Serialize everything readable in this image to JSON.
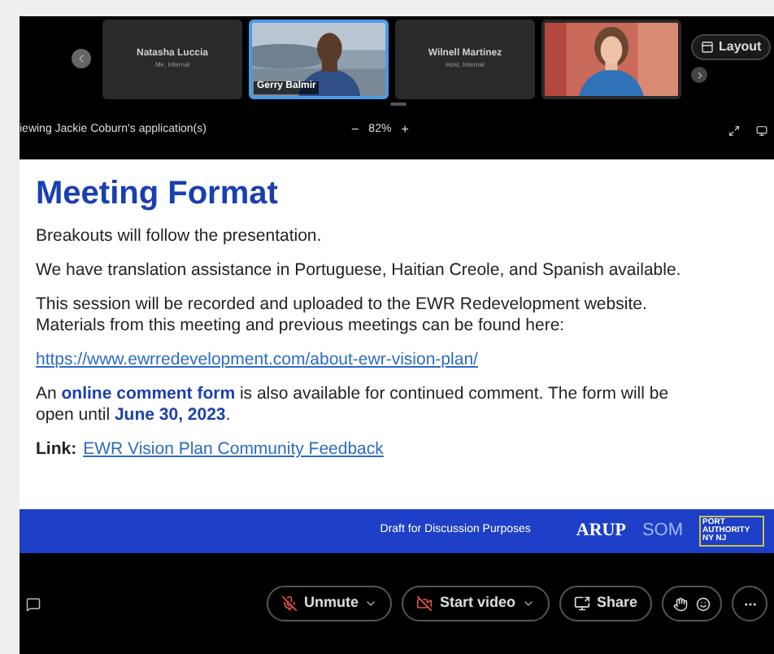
{
  "participants": [
    {
      "name": "Natasha Luccia",
      "role": "Me, Internal",
      "kind": "avatar",
      "selected": false
    },
    {
      "name": "Gerry Balmir",
      "kind": "video",
      "selected": true
    },
    {
      "name": "Wilnell Martinez",
      "role": "Host, Internal",
      "kind": "avatar",
      "selected": false
    },
    {
      "kind": "video",
      "selected": false
    }
  ],
  "layout_button": "Layout",
  "share_bar": {
    "label": "iewing Jackie Coburn's application(s)",
    "zoom_out": "−",
    "zoom": "82%",
    "zoom_in": "+"
  },
  "slide": {
    "title": "Meeting Format",
    "paragraphs": [
      {
        "kind": "text",
        "text": "Breakouts will follow the presentation."
      },
      {
        "kind": "text",
        "text": "We have translation assistance in Portuguese, Haitian Creole, and Spanish available."
      },
      {
        "kind": "text",
        "text": "This session will be recorded and uploaded to the EWR Redevelopment website. Materials from this meeting and previous meetings can be found here:"
      },
      {
        "kind": "url",
        "text": "https://www.ewrredevelopment.com/about-ewr-vision-plan/"
      },
      {
        "kind": "text",
        "text": "An **online comment form** is also available for continued comment. The form will be open until **June 30, 2023**."
      },
      {
        "kind": "link",
        "label": "Link:",
        "text": "EWR Vision Plan Community Feedback"
      }
    ],
    "footer": {
      "note": "Draft for Discussion Purposes",
      "logos": [
        "ARUP",
        "SOM"
      ],
      "authority": "PORT AUTHORITY NY NJ"
    }
  },
  "toolbar": [
    {
      "kind": "mic",
      "label": "Unmute",
      "dropdown": true
    },
    {
      "kind": "video",
      "label": "Start video",
      "dropdown": true
    },
    {
      "kind": "share",
      "label": "Share",
      "dropdown": false
    }
  ]
}
